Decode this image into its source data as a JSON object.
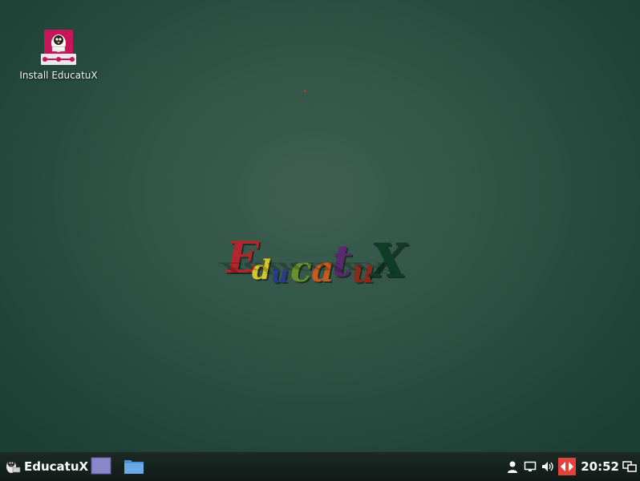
{
  "desktop": {
    "icons": [
      {
        "label": "Install EducatuX",
        "icon": "installer-icon"
      }
    ]
  },
  "wallpaper": {
    "logo_text": "EducatuX",
    "logo_letters": [
      {
        "ch": "E",
        "color": "#b3262e"
      },
      {
        "ch": "d",
        "color": "#d8c52a"
      },
      {
        "ch": "u",
        "color": "#2b3a8c"
      },
      {
        "ch": "c",
        "color": "#6b8f2a"
      },
      {
        "ch": "a",
        "color": "#c85a1e"
      },
      {
        "ch": "t",
        "color": "#5b2a6e"
      },
      {
        "ch": "u",
        "color": "#8a2a1e"
      },
      {
        "ch": "X",
        "color": "#0f3d28"
      }
    ]
  },
  "taskbar": {
    "menu_label": "EducatuX",
    "menu_icon": "penguin-menu-icon",
    "launchers": [
      "show-desktop-icon",
      "file-manager-icon"
    ],
    "tray": [
      "user-icon",
      "display-icon",
      "volume-icon",
      "network-icon",
      "window-switch-icon"
    ],
    "clock": "20:52"
  },
  "colors": {
    "taskbar_bg": "#141f1c",
    "desktop_bg": "#2f5446",
    "accent_red": "#e3413c"
  }
}
